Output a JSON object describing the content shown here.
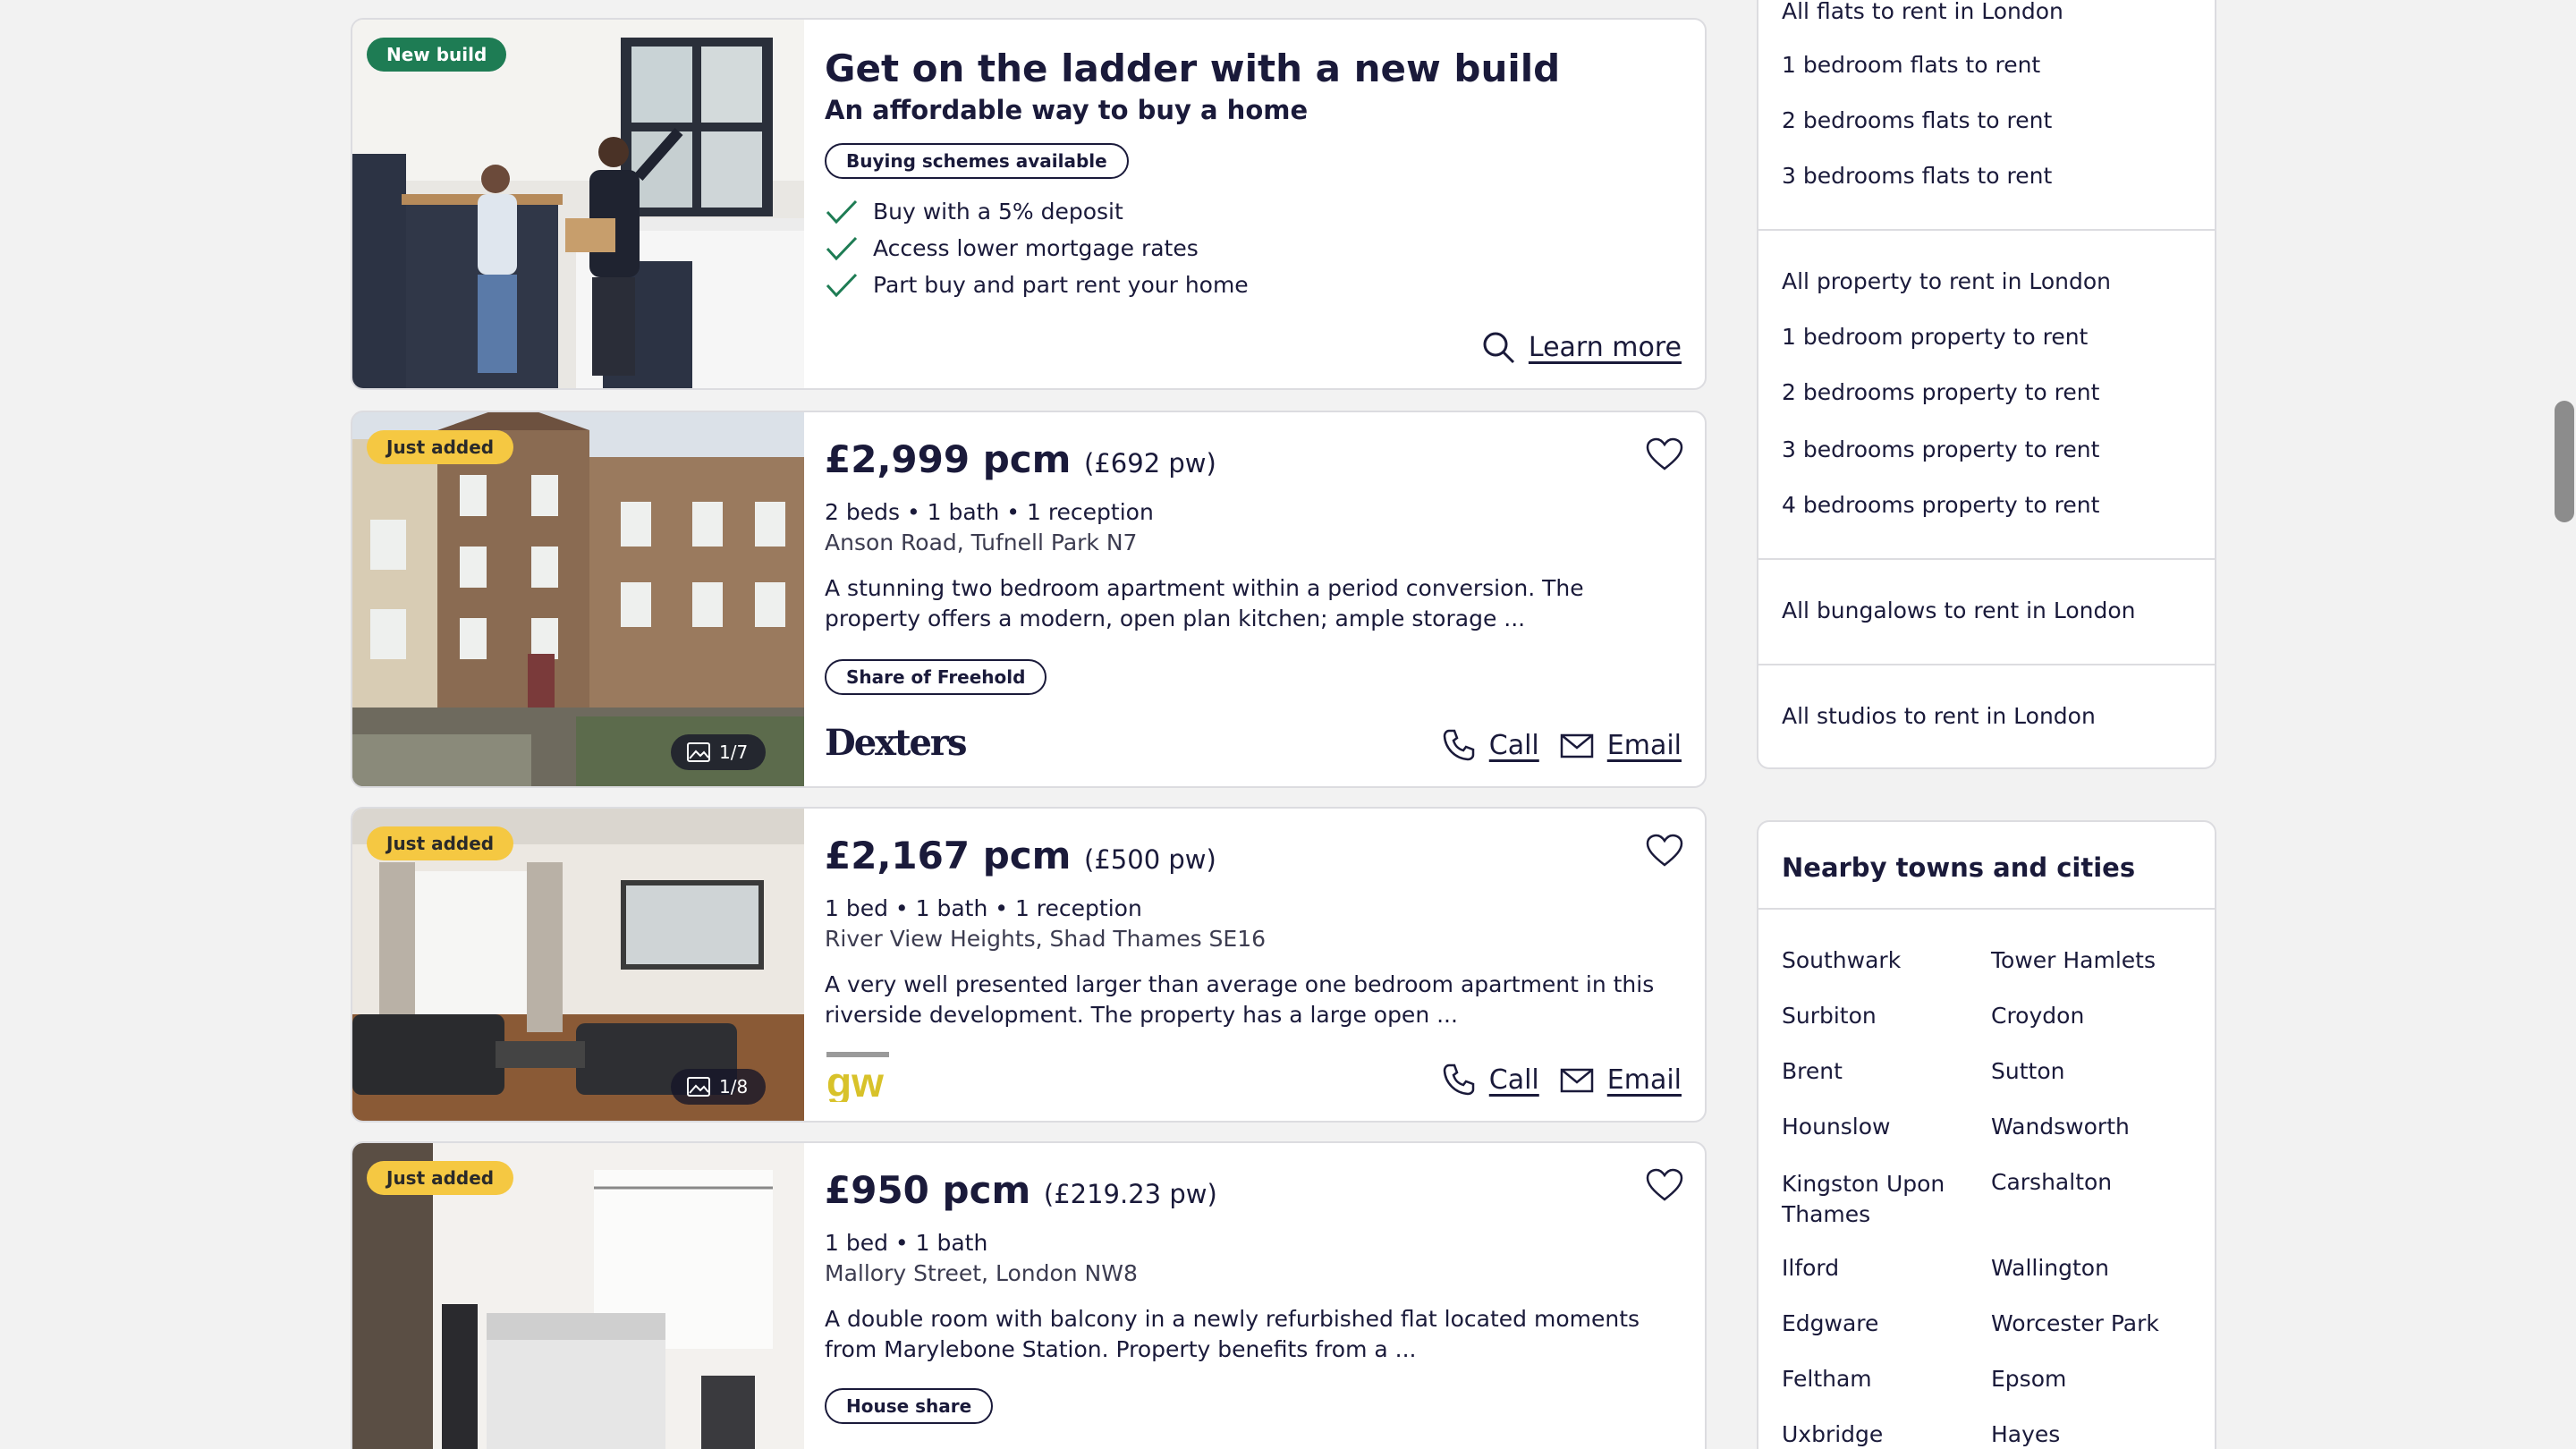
{
  "promo": {
    "badge": "New build",
    "title": "Get on the ladder with a new build",
    "subtitle": "An affordable way to buy a home",
    "pill": "Buying schemes available",
    "checks": [
      "Buy with a 5% deposit",
      "Access lower mortgage rates",
      "Part buy and part rent your home"
    ],
    "learn_more": "Learn more"
  },
  "listings": [
    {
      "badge": "Just added",
      "price": "£2,999 pcm",
      "price_pw": "(£692 pw)",
      "specs": "2 beds • 1 bath • 1 reception",
      "address": "Anson Road, Tufnell Park N7",
      "desc": "A stunning two bedroom apartment within a period conversion. The property offers a modern, open plan kitchen; ample storage ...",
      "tag": "Share of Freehold",
      "agent": "Dexters",
      "photos": "1/7",
      "call": "Call",
      "email": "Email"
    },
    {
      "badge": "Just added",
      "price": "£2,167 pcm",
      "price_pw": "(£500 pw)",
      "specs": "1 bed • 1 bath • 1 reception",
      "address": "River View Heights, Shad Thames SE16",
      "desc": "A very well presented larger than average one bedroom apartment in this riverside development. The property has a large open ...",
      "agent": "gw",
      "photos": "1/8",
      "call": "Call",
      "email": "Email"
    },
    {
      "badge": "Just added",
      "price": "£950 pcm",
      "price_pw": "(£219.23 pw)",
      "specs": "1 bed • 1 bath",
      "address": "Mallory Street, London NW8",
      "desc": "A double room with balcony in a newly refurbished flat located moments from Marylebone Station. Property benefits from a ...",
      "tag": "House share"
    }
  ],
  "sidebar": {
    "flats": [
      "All flats to rent in London",
      "1 bedroom flats to rent",
      "2 bedrooms flats to rent",
      "3 bedrooms flats to rent"
    ],
    "property": [
      "All property to rent in London",
      "1 bedroom property to rent",
      "2 bedrooms property to rent",
      "3 bedrooms property to rent",
      "4 bedrooms property to rent"
    ],
    "bungalows": "All bungalows to rent in London",
    "studios": "All studios to rent in London",
    "nearby_title": "Nearby towns and cities",
    "nearby_left": [
      "Southwark",
      "Surbiton",
      "Brent",
      "Hounslow",
      "Kingston Upon Thames",
      "Ilford",
      "Edgware",
      "Feltham",
      "Uxbridge"
    ],
    "nearby_right": [
      "Tower Hamlets",
      "Croydon",
      "Sutton",
      "Wandsworth",
      "Carshalton",
      "Wallington",
      "Worcester Park",
      "Epsom",
      "Hayes"
    ]
  },
  "colors": {
    "accent_green": "#1e7c54",
    "badge_yellow": "#f5c842",
    "text_dark": "#1a1a3a"
  }
}
